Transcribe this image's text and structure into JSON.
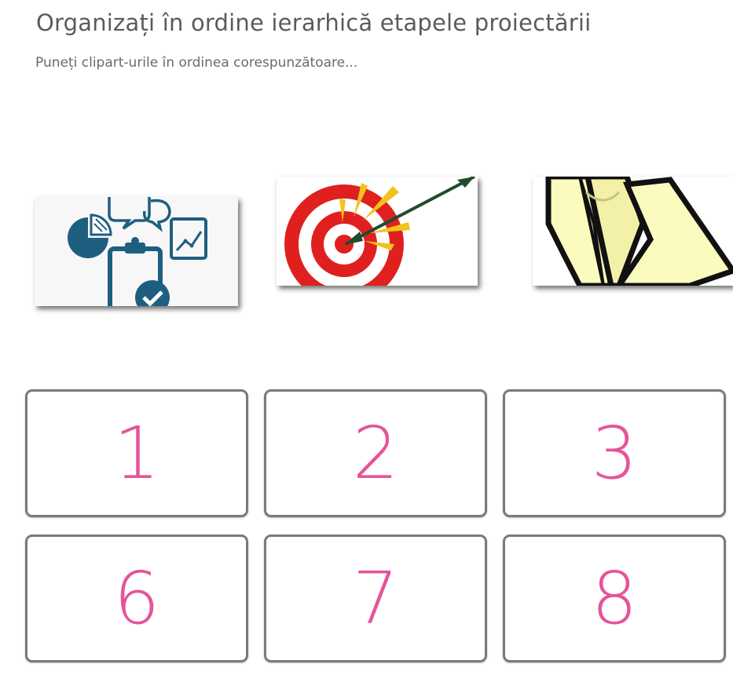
{
  "header": {
    "title": "Organizați în ordine ierarhică etapele proiectării",
    "subtitle": "Puneți clipart-urile în ordinea corespunzătoare..."
  },
  "cliparts": [
    {
      "icon": "analysis-clipboard-icon"
    },
    {
      "icon": "target-arrow-icon"
    },
    {
      "icon": "folded-map-icon"
    }
  ],
  "slots": [
    {
      "label": "1"
    },
    {
      "label": "2"
    },
    {
      "label": "3"
    },
    {
      "label": "6"
    },
    {
      "label": "7"
    },
    {
      "label": "8"
    }
  ],
  "colors": {
    "number": "#e5549a",
    "slot_border": "#7a7a7a",
    "title": "#5b5b5b",
    "icon_blue": "#1e5f80",
    "target_red": "#e0201f",
    "arrow_green": "#1f4d2c",
    "map_fill": "#fbfbbf"
  }
}
